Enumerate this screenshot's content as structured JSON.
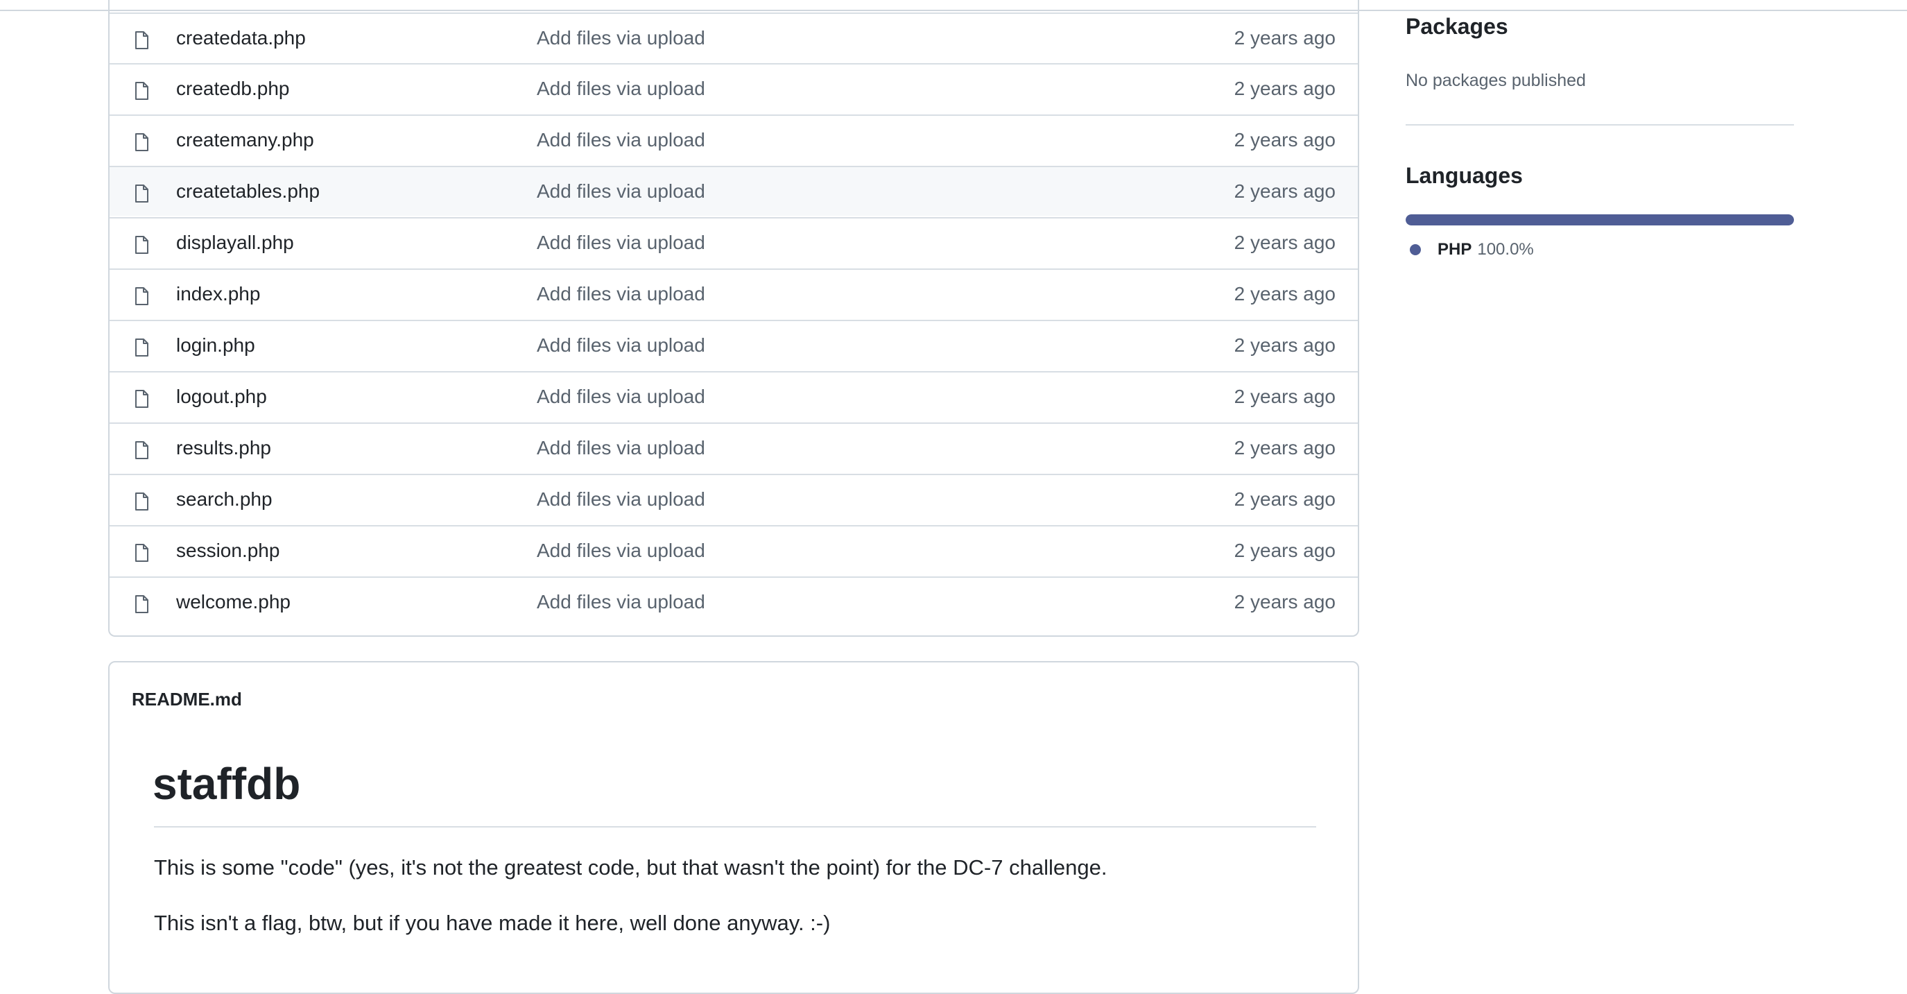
{
  "files": [
    {
      "name": "createdata.php",
      "message": "Add files via upload",
      "age": "2 years ago"
    },
    {
      "name": "createdb.php",
      "message": "Add files via upload",
      "age": "2 years ago"
    },
    {
      "name": "createmany.php",
      "message": "Add files via upload",
      "age": "2 years ago"
    },
    {
      "name": "createtables.php",
      "message": "Add files via upload",
      "age": "2 years ago"
    },
    {
      "name": "displayall.php",
      "message": "Add files via upload",
      "age": "2 years ago"
    },
    {
      "name": "index.php",
      "message": "Add files via upload",
      "age": "2 years ago"
    },
    {
      "name": "login.php",
      "message": "Add files via upload",
      "age": "2 years ago"
    },
    {
      "name": "logout.php",
      "message": "Add files via upload",
      "age": "2 years ago"
    },
    {
      "name": "results.php",
      "message": "Add files via upload",
      "age": "2 years ago"
    },
    {
      "name": "search.php",
      "message": "Add files via upload",
      "age": "2 years ago"
    },
    {
      "name": "session.php",
      "message": "Add files via upload",
      "age": "2 years ago"
    },
    {
      "name": "welcome.php",
      "message": "Add files via upload",
      "age": "2 years ago"
    }
  ],
  "file_icon": "file-icon",
  "readme": {
    "filename": "README.md",
    "title": "staffdb",
    "paragraphs": [
      "This is some \"code\" (yes, it's not the greatest code, but that wasn't the point) for the DC-7 challenge.",
      "This isn't a flag, btw, but if you have made it here, well done anyway. :-)"
    ]
  },
  "sidebar": {
    "packages": {
      "heading": "Packages",
      "text": "No packages published"
    },
    "languages": {
      "heading": "Languages",
      "items": [
        {
          "name": "PHP",
          "percent": "100.0%",
          "fraction": 1.0,
          "color": "#4F5D95"
        }
      ]
    }
  },
  "colors": {
    "border": "#d0d7de",
    "hover_row": "#f6f8fa",
    "muted_text": "#59636e"
  }
}
